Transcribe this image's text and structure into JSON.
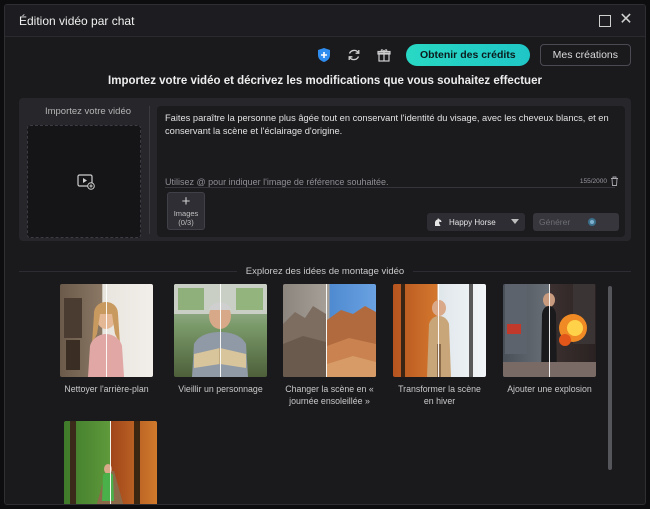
{
  "window": {
    "title": "Édition vidéo par chat"
  },
  "toolbar": {
    "credits_label": "Obtenir des crédits",
    "creations_label": "Mes créations",
    "icons": [
      "shield-plus-icon",
      "refresh-icon",
      "gift-icon"
    ]
  },
  "heading": "Importez votre vidéo et décrivez les modifications que vous souhaitez effectuer",
  "upload": {
    "label": "Importez votre vidéo"
  },
  "prompt": {
    "text": "Faites paraître la personne plus âgée tout en conservant l'identité du visage, avec les cheveux blancs, et en conservant la scène et l'éclairage d'origine.",
    "hint": "Utilisez @ pour indiquer l'image de référence souhaitée.",
    "counter": "155/2000"
  },
  "images_button": {
    "plus": "+",
    "label": "Images",
    "count": "(0/3)"
  },
  "model": {
    "name": "Happy Horse"
  },
  "generate": {
    "label": "Générer"
  },
  "explore": {
    "title": "Explorez des idées de montage vidéo"
  },
  "ideas": [
    {
      "label": "Nettoyer l'arrière-plan"
    },
    {
      "label": "Vieillir un personnage"
    },
    {
      "label": "Changer la scène en « journée ensoleillée »"
    },
    {
      "label": "Transformer la scène en hiver"
    },
    {
      "label": "Ajouter une explosion"
    },
    {
      "label": ""
    }
  ],
  "colors": {
    "accent": "#22d3c5",
    "background": "#1a1a1d",
    "panel": "#26262b"
  }
}
